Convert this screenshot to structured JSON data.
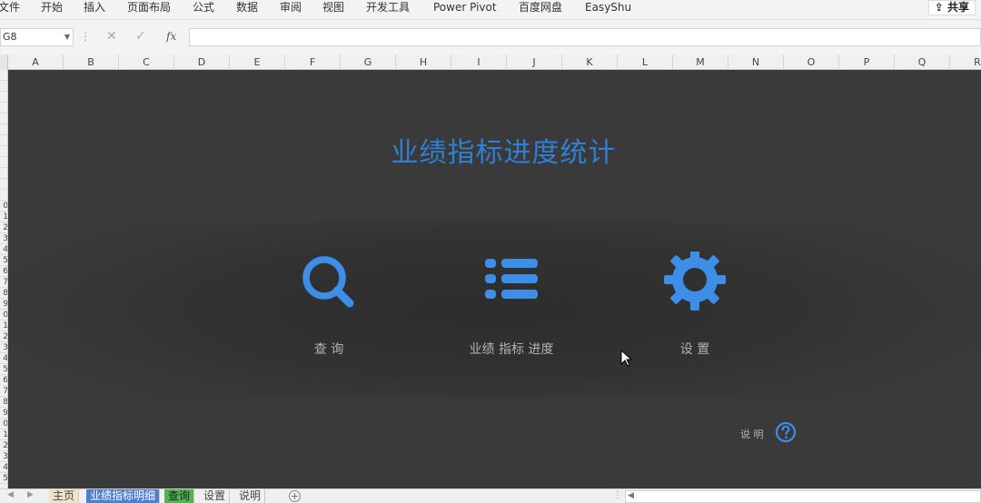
{
  "menu": {
    "items": [
      "文件",
      "开始",
      "插入",
      "页面布局",
      "公式",
      "数据",
      "审阅",
      "视图",
      "开发工具",
      "Power Pivot",
      "百度网盘",
      "EasyShu"
    ],
    "share": "共享"
  },
  "formula_bar": {
    "name_box": "G8",
    "fx": "fx",
    "value": ""
  },
  "columns": [
    "A",
    "B",
    "C",
    "D",
    "E",
    "F",
    "G",
    "H",
    "I",
    "J",
    "K",
    "L",
    "M",
    "N",
    "O",
    "P",
    "Q",
    "R"
  ],
  "rows": [
    "",
    "",
    "",
    "",
    "",
    "",
    "",
    "",
    "",
    "",
    "",
    "",
    "0",
    "1",
    "2",
    "3",
    "4",
    "5",
    "6",
    "7",
    "8",
    "9",
    "0",
    "1",
    "2",
    "3",
    "4",
    "5",
    "6",
    "7",
    "8",
    "9",
    "0",
    "1",
    "2",
    "3",
    "4",
    "5"
  ],
  "dashboard": {
    "title": "业绩指标进度统计",
    "tiles": [
      {
        "label": "查 询",
        "icon": "search-icon"
      },
      {
        "label": "业绩 指标 进度",
        "icon": "list-icon"
      },
      {
        "label": "设 置",
        "icon": "gear-icon"
      }
    ],
    "help_label": "说 明",
    "help_icon": "question-icon",
    "accent_color": "#2f7fd4"
  },
  "sheet_tabs": [
    {
      "label": "主页",
      "color": "#f3e0c8"
    },
    {
      "label": "业绩指标明细",
      "color": "#4f7fcf"
    },
    {
      "label": "查询",
      "color": "#55b24e"
    },
    {
      "label": "设置",
      "color": ""
    },
    {
      "label": "说明",
      "color": ""
    }
  ]
}
